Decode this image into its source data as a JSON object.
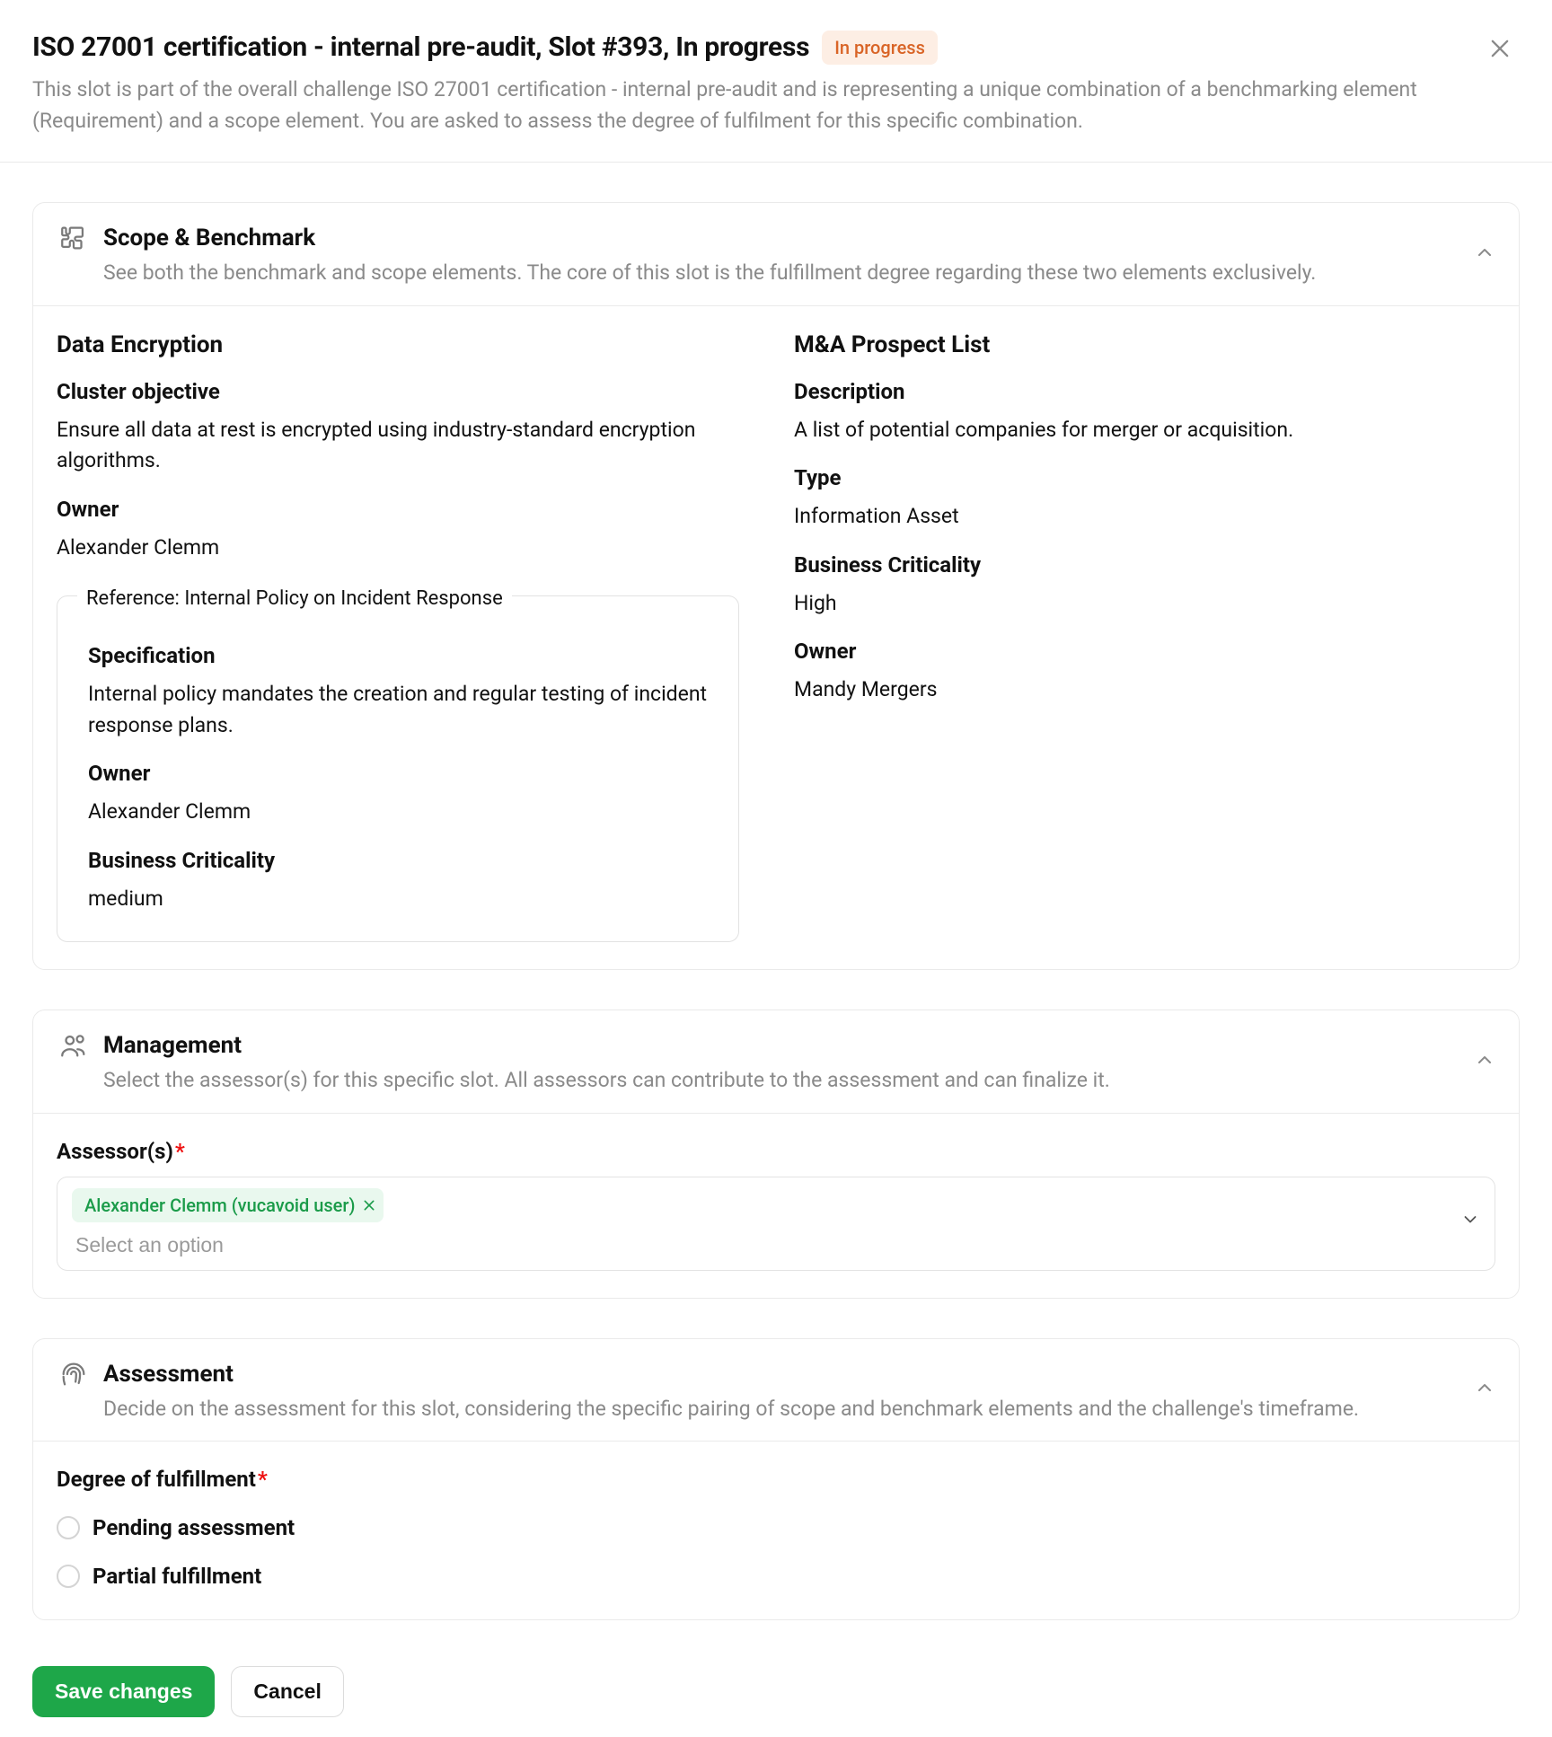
{
  "header": {
    "title": "ISO 27001 certification - internal pre-audit, Slot #393, In progress",
    "status": "In progress",
    "subtitle": "This slot is part of the overall challenge ISO 27001 certification - internal pre-audit and is representing a unique combination of a benchmarking element (Requirement) and a scope element. You are asked to assess the degree of fulfilment for this specific combination."
  },
  "scope": {
    "title": "Scope & Benchmark",
    "subtitle": "See both the benchmark and scope elements. The core of this slot is the fulfillment degree regarding these two elements exclusively.",
    "left": {
      "title": "Data Encryption",
      "objective_label": "Cluster objective",
      "objective": "Ensure all data at rest is encrypted using industry-standard encryption algorithms.",
      "owner_label": "Owner",
      "owner": "Alexander Clemm",
      "reference": {
        "legend": "Reference: Internal Policy on Incident Response",
        "spec_label": "Specification",
        "spec": "Internal policy mandates the creation and regular testing of incident response plans.",
        "owner_label": "Owner",
        "owner": "Alexander Clemm",
        "crit_label": "Business Criticality",
        "crit": "medium"
      }
    },
    "right": {
      "title": "M&A Prospect List",
      "desc_label": "Description",
      "desc": "A list of potential companies for merger or acquisition.",
      "type_label": "Type",
      "type": "Information Asset",
      "crit_label": "Business Criticality",
      "crit": "High",
      "owner_label": "Owner",
      "owner": "Mandy Mergers"
    }
  },
  "management": {
    "title": "Management",
    "subtitle": "Select the assessor(s) for this specific slot. All assessors can contribute to the assessment and can finalize it.",
    "assessors_label": "Assessor(s)",
    "chip": "Alexander Clemm (vucavoid user)",
    "placeholder": "Select an option"
  },
  "assessment": {
    "title": "Assessment",
    "subtitle": "Decide on the assessment for this slot, considering the specific pairing of scope and benchmark elements and the challenge's timeframe.",
    "degree_label": "Degree of fulfillment",
    "options": [
      "Pending assessment",
      "Partial fulfillment"
    ]
  },
  "footer": {
    "save": "Save changes",
    "cancel": "Cancel"
  }
}
